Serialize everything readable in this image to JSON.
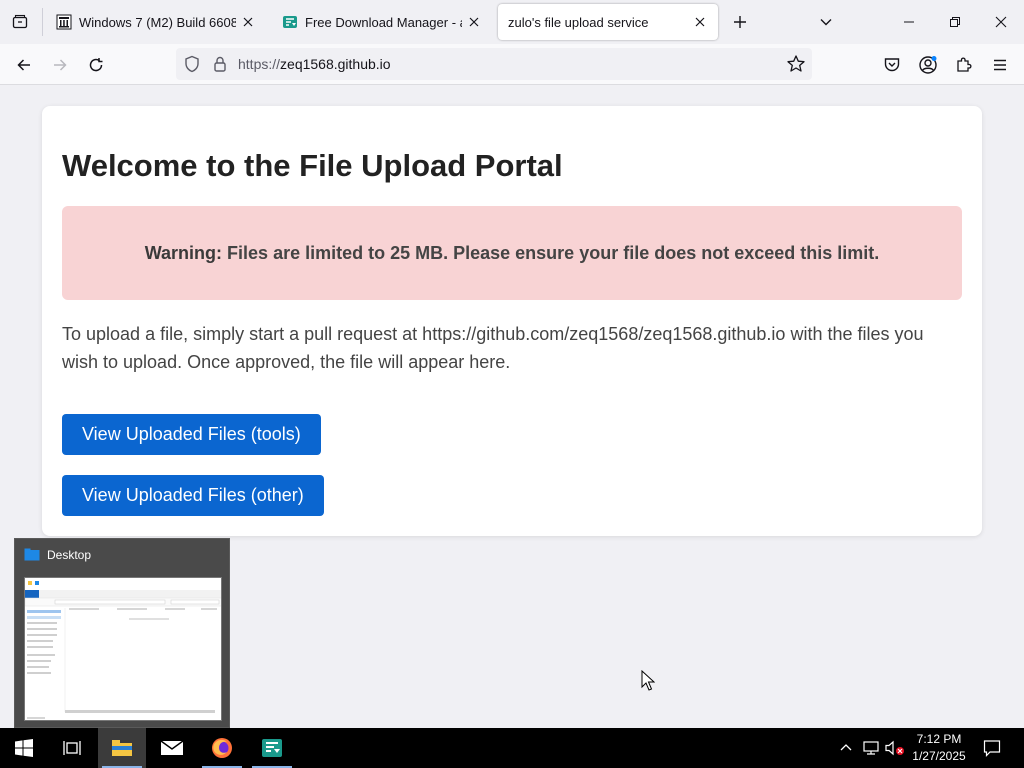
{
  "browser": {
    "tabs": [
      {
        "title": "Windows 7 (M2) Build 6608 : Mi",
        "favicon": "archive-org-icon",
        "active": false
      },
      {
        "title": "Free Download Manager - abso",
        "favicon": "fdm-icon",
        "active": false
      },
      {
        "title": "zulo's file upload service",
        "favicon": "none",
        "active": true
      }
    ],
    "address": {
      "scheme": "https://",
      "host": "zeq1568.github.io"
    }
  },
  "page": {
    "title": "Welcome to the File Upload Portal",
    "warning": {
      "label": "Warning:",
      "text": "Files are limited to 25 MB. Please ensure your file does not exceed this limit."
    },
    "intro": "To upload a file, simply start a pull request at https://github.com/zeq1568/zeq1568.github.io with the files you wish to upload. Once approved, the file will appear here.",
    "buttons": [
      {
        "label": "View Uploaded Files (tools)"
      },
      {
        "label": "View Uploaded Files (other)"
      }
    ]
  },
  "taskbar_preview": {
    "title": "Desktop"
  },
  "taskbar": {
    "time": "7:12 PM",
    "date": "1/27/2025"
  },
  "colors": {
    "accent": "#0b66d0",
    "warning_bg": "#f8d3d4",
    "taskbar": "#000000"
  }
}
